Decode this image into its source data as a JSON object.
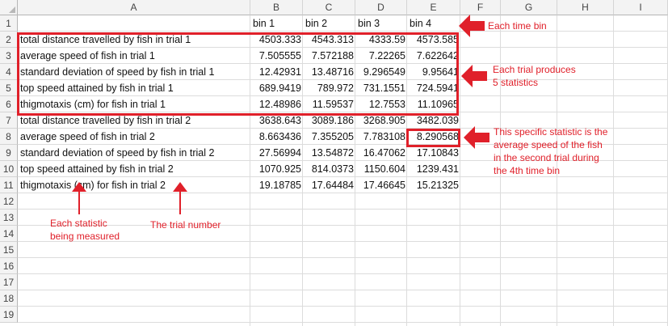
{
  "columns": [
    "A",
    "B",
    "C",
    "D",
    "E",
    "F",
    "G",
    "H",
    "I"
  ],
  "rows": [
    "1",
    "2",
    "3",
    "4",
    "5",
    "6",
    "7",
    "8",
    "9",
    "10",
    "11",
    "12",
    "13",
    "14",
    "15",
    "16",
    "17",
    "18",
    "19"
  ],
  "header_row": [
    "",
    "bin  1",
    "bin  2",
    "bin  3",
    "bin  4"
  ],
  "data_rows": [
    [
      "total distance travelled by fish in trial 1",
      "4503.333",
      "4543.313",
      "4333.59",
      "4573.585"
    ],
    [
      "average speed of fish in trial  1",
      "7.505555",
      "7.572188",
      "7.22265",
      "7.622642"
    ],
    [
      "standard deviation of speed by fish in trial  1",
      "12.42931",
      "13.48716",
      "9.296549",
      "9.95641"
    ],
    [
      "top speed attained by fish in trial  1",
      "689.9419",
      "789.972",
      "731.1551",
      "724.5941"
    ],
    [
      "thigmotaxis (cm) for fish in trial  1",
      "12.48986",
      "11.59537",
      "12.7553",
      "11.10965"
    ],
    [
      "total distance travelled by fish in trial 2",
      "3638.643",
      "3089.186",
      "3268.905",
      "3482.039"
    ],
    [
      "average speed of fish in trial  2",
      "8.663436",
      "7.355205",
      "7.783108",
      "8.290568"
    ],
    [
      "standard deviation of speed by fish in trial  2",
      "27.56994",
      "13.54872",
      "16.47062",
      "17.10843"
    ],
    [
      "top speed attained by fish in trial  2",
      "1070.925",
      "814.0373",
      "1150.604",
      "1239.431"
    ],
    [
      "thigmotaxis (cm) for fish in trial  2",
      "19.18785",
      "17.64484",
      "17.46645",
      "15.21325"
    ]
  ],
  "annotations": {
    "time_bin": "Each time bin",
    "trial_produces_line1": "Each trial produces",
    "trial_produces_line2": "5 statistics",
    "specific_line1": "This specific statistic is the",
    "specific_line2": "average speed of the fish",
    "specific_line3": "in the second trial during",
    "specific_line4": "the 4th time bin",
    "statistic_line1": "Each statistic",
    "statistic_line2": "being measured",
    "trial_number": "The trial number"
  },
  "colors": {
    "annotation_red": "#e0202a",
    "header_bg": "#f3f3f3",
    "grid": "#dcdcdc"
  }
}
